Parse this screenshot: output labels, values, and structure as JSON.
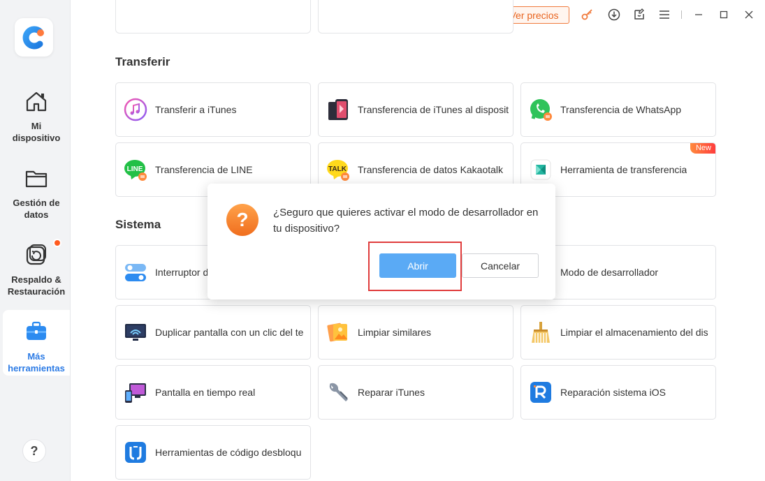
{
  "sidebar": {
    "items": [
      {
        "label": "Mi\ndispositivo"
      },
      {
        "label": "Gestión de\ndatos"
      },
      {
        "label": "Respaldo &\nRestauración"
      },
      {
        "label": "Más\nherramientas"
      }
    ],
    "help": "?"
  },
  "titlebar": {
    "price_label": "Ver precios",
    "accent": "#f07a3c"
  },
  "sections": {
    "transfer_title": "Transferir",
    "system_title": "Sistema"
  },
  "transfer_cards": [
    {
      "label": "Transferir a iTunes",
      "icon": "itunes-icon"
    },
    {
      "label": "Transferencia de iTunes al disposit",
      "icon": "itunes-device-icon"
    },
    {
      "label": "Transferencia de WhatsApp",
      "icon": "whatsapp-icon"
    },
    {
      "label": "Transferencia de LINE",
      "icon": "line-icon"
    },
    {
      "label": "Transferencia de datos Kakaotalk",
      "icon": "kakaotalk-icon"
    },
    {
      "label": "Herramienta de transferencia",
      "icon": "transfer-tool-icon",
      "badge": "New"
    }
  ],
  "system_cards": [
    {
      "label": "Interruptor d",
      "icon": "switch-icon"
    },
    {
      "label": "Modo de desarrollador",
      "icon": "developer-icon"
    },
    {
      "label": "Duplicar pantalla con un clic del te",
      "icon": "mirror-icon"
    },
    {
      "label": "Limpiar similares",
      "icon": "photos-icon"
    },
    {
      "label": "Limpiar el almacenamiento del dis",
      "icon": "broom-icon"
    },
    {
      "label": "Pantalla en tiempo real",
      "icon": "realtime-screen-icon"
    },
    {
      "label": "Reparar iTunes",
      "icon": "wrench-icon"
    },
    {
      "label": "Reparación sistema iOS",
      "icon": "ios-repair-icon"
    },
    {
      "label": "Herramientas de código desbloqu",
      "icon": "unlock-code-icon"
    }
  ],
  "dialog": {
    "message": "¿Seguro que quieres activar el modo de desarrollador en tu dispositivo?",
    "confirm_label": "Abrir",
    "cancel_label": "Cancelar",
    "confirm_color": "#5aaaf5",
    "highlight_color": "#e03c3c"
  }
}
